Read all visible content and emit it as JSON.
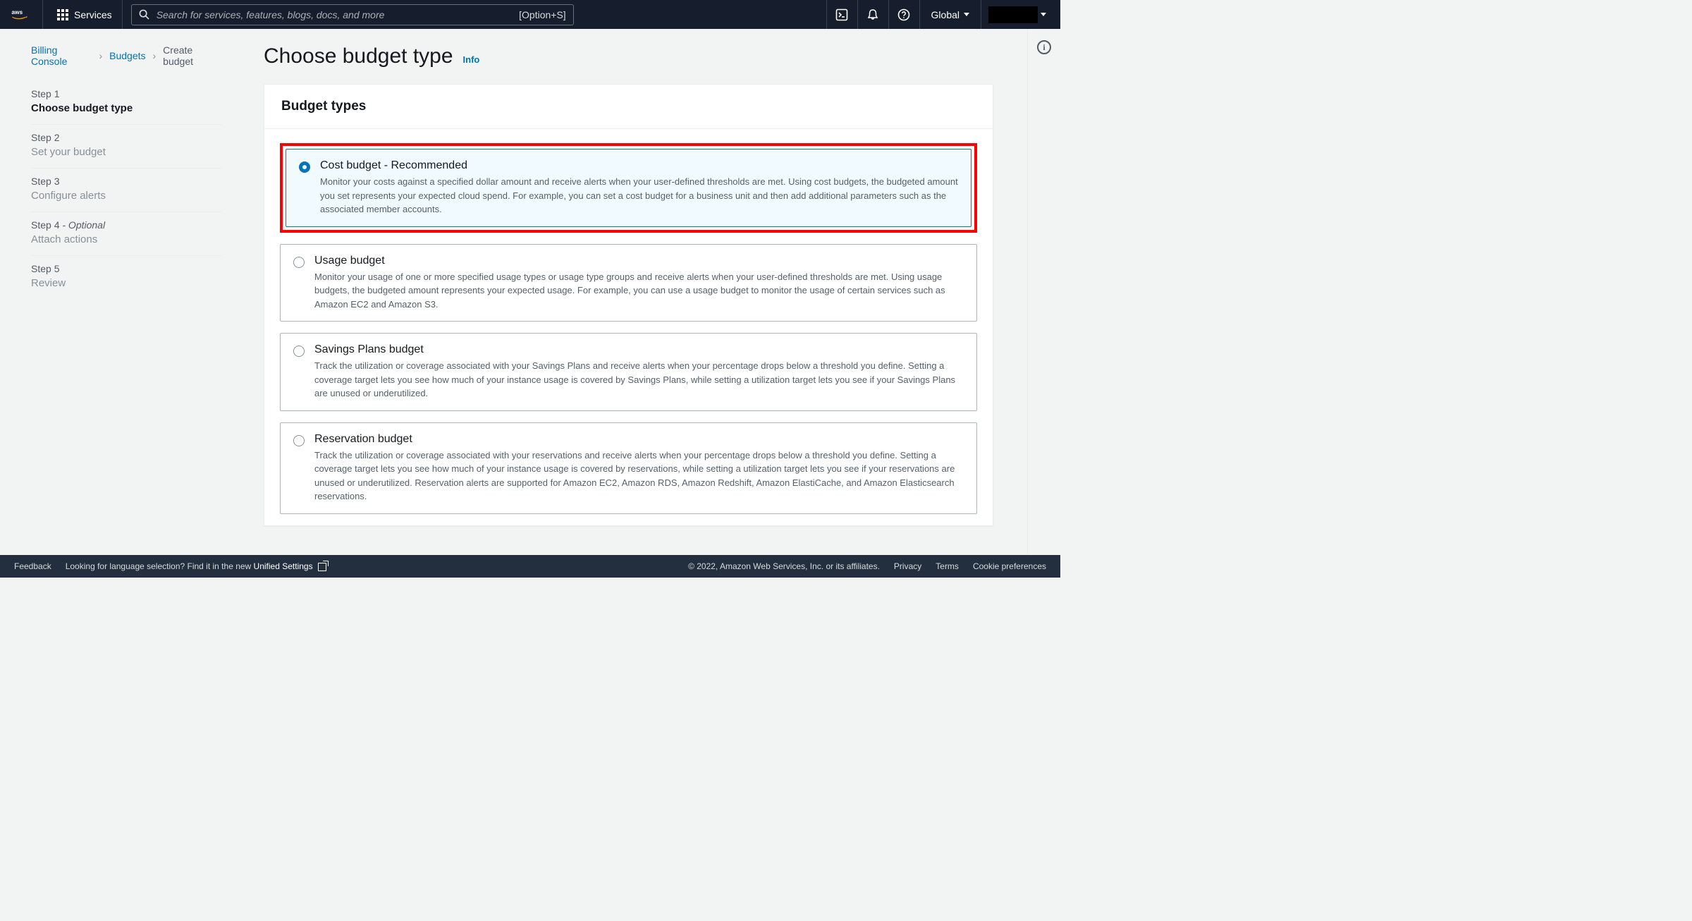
{
  "topnav": {
    "services_label": "Services",
    "search_placeholder": "Search for services, features, blogs, docs, and more",
    "search_shortcut": "[Option+S]",
    "region": "Global"
  },
  "breadcrumb": {
    "0": "Billing Console",
    "1": "Budgets",
    "2": "Create budget"
  },
  "steps": [
    {
      "num": "Step 1",
      "title": "Choose budget type",
      "active": true,
      "optional": false
    },
    {
      "num": "Step 2",
      "title": "Set your budget",
      "active": false,
      "optional": false
    },
    {
      "num": "Step 3",
      "title": "Configure alerts",
      "active": false,
      "optional": false
    },
    {
      "num": "Step 4",
      "title": "Attach actions",
      "active": false,
      "optional": true,
      "opt_label": " - Optional"
    },
    {
      "num": "Step 5",
      "title": "Review",
      "active": false,
      "optional": false
    }
  ],
  "heading": "Choose budget type",
  "heading_info": "Info",
  "panel_title": "Budget types",
  "options": [
    {
      "title": "Cost budget - Recommended",
      "desc": "Monitor your costs against a specified dollar amount and receive alerts when your user-defined thresholds are met. Using cost budgets, the budgeted amount you set represents your expected cloud spend. For example, you can set a cost budget for a business unit and then add additional parameters such as the associated member accounts.",
      "selected": true,
      "highlight": true
    },
    {
      "title": "Usage budget",
      "desc": "Monitor your usage of one or more specified usage types or usage type groups and receive alerts when your user-defined thresholds are met. Using usage budgets, the budgeted amount represents your expected usage. For example, you can use a usage budget to monitor the usage of certain services such as Amazon EC2 and Amazon S3.",
      "selected": false,
      "highlight": false
    },
    {
      "title": "Savings Plans budget",
      "desc": "Track the utilization or coverage associated with your Savings Plans and receive alerts when your percentage drops below a threshold you define. Setting a coverage target lets you see how much of your instance usage is covered by Savings Plans, while setting a utilization target lets you see if your Savings Plans are unused or underutilized.",
      "selected": false,
      "highlight": false
    },
    {
      "title": "Reservation budget",
      "desc": "Track the utilization or coverage associated with your reservations and receive alerts when your percentage drops below a threshold you define. Setting a coverage target lets you see how much of your instance usage is covered by reservations, while setting a utilization target lets you see if your reservations are unused or underutilized. Reservation alerts are supported for Amazon EC2, Amazon RDS, Amazon Redshift, Amazon ElastiCache, and Amazon Elasticsearch reservations.",
      "selected": false,
      "highlight": false
    }
  ],
  "footer": {
    "feedback": "Feedback",
    "lang_hint": "Looking for language selection? Find it in the new ",
    "unified": "Unified Settings",
    "copyright": "© 2022, Amazon Web Services, Inc. or its affiliates.",
    "privacy": "Privacy",
    "terms": "Terms",
    "cookie": "Cookie preferences"
  }
}
